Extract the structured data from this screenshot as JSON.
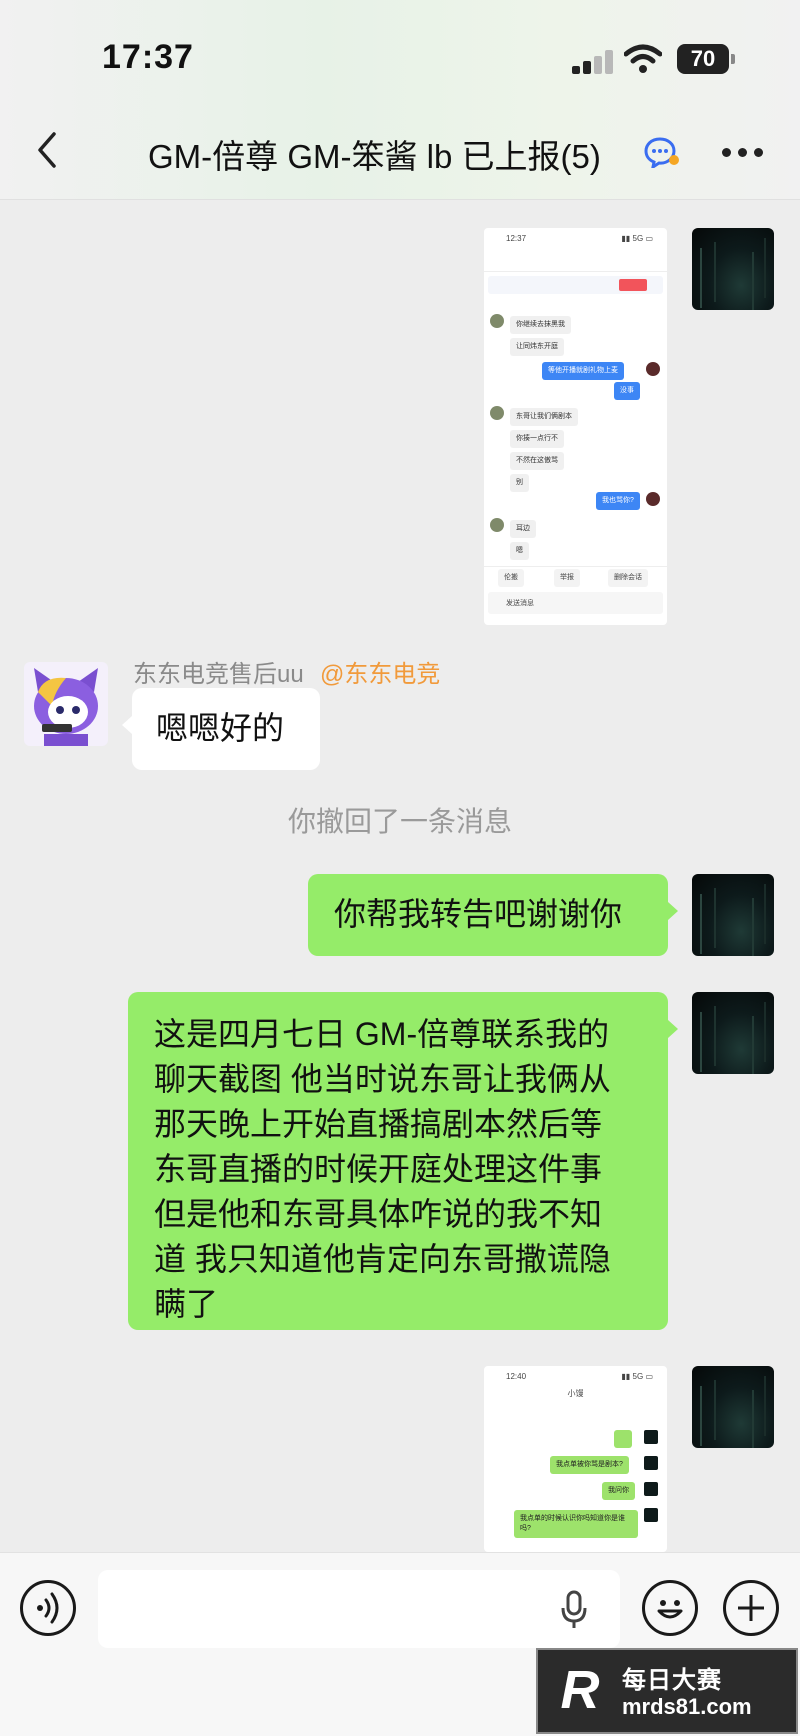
{
  "status_bar": {
    "time": "17:37",
    "battery": "70"
  },
  "header": {
    "title": "GM-倍尊 GM-笨酱  lb 已上报(5)"
  },
  "shot1": {
    "time": "12:37",
    "lines_left": [
      "你继续去抹黑我",
      "让同炜东开庭",
      "东哥让我们俩剧本",
      "你揍一点行不",
      "不然在这傲骂",
      "别",
      "耳边",
      "嗯"
    ],
    "lines_right": [
      "等他开播就剧礼物上麦",
      "没事",
      "我也骂你?"
    ],
    "toolbar": [
      "伦搬",
      "举报",
      "删除会话"
    ],
    "input_placeholder": "发送消息"
  },
  "messages": {
    "sender_name": "东东电竞售后uu",
    "mention": "@东东电竞",
    "reply_text": "嗯嗯好的",
    "system_text": "你撤回了一条消息",
    "forward_text": "你帮我转告吧谢谢你",
    "long_text_lines": [
      "这是四月七日 GM-倍尊联系我的",
      "聊天截图 他当时说东哥让我俩从",
      "那天晚上开始直播搞剧本然后等",
      "东哥直播的时候开庭处理这件事",
      "但是他和东哥具体咋说的我不知",
      "道 我只知道他肯定向东哥撒谎隐",
      "瞒了"
    ]
  },
  "shot2": {
    "time": "12:40",
    "title": "小馒",
    "lines_right": [
      "我点单被你骂是剧本?",
      "我问你",
      "我点单的时候认识你吗知道你是谁吗?"
    ]
  },
  "watermark": {
    "logo": "R",
    "line1": "每日大赛",
    "line2": "mrds81.com"
  },
  "colors": {
    "bubble_green": "#95ec69",
    "mention_orange": "#f19a3b",
    "background": "#ededed"
  }
}
